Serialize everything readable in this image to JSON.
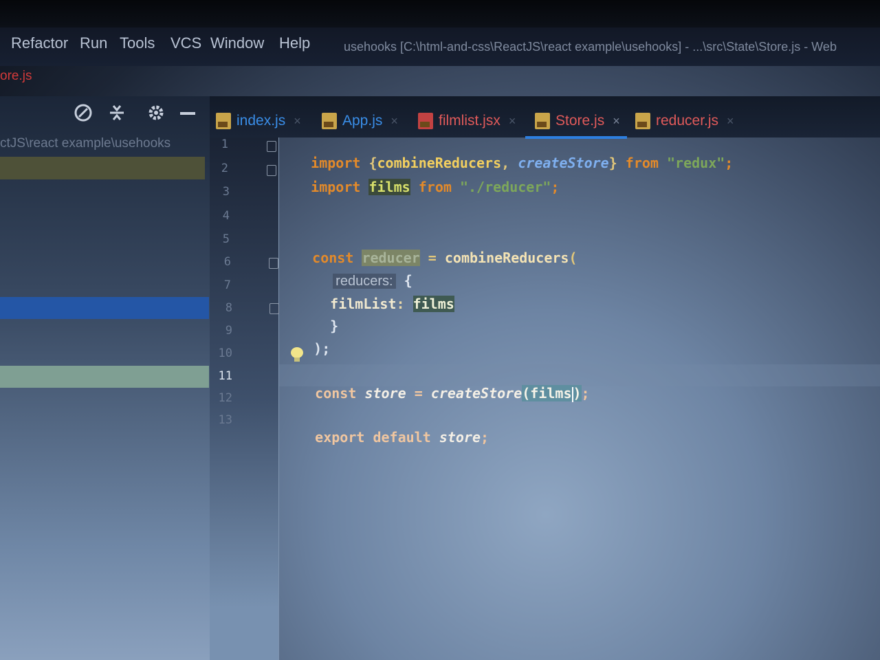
{
  "menu": [
    {
      "label": "Refactor",
      "mnemonic": "R"
    },
    {
      "label": "Run",
      "mnemonic": "u"
    },
    {
      "label": "Tools",
      "mnemonic": "T"
    },
    {
      "label": "VCS",
      "mnemonic": "S"
    },
    {
      "label": "Window",
      "mnemonic": "W"
    },
    {
      "label": "Help",
      "mnemonic": "H"
    }
  ],
  "window_title": "usehooks [C:\\html-and-css\\ReactJS\\react example\\usehooks] - ...\\src\\State\\Store.js - Web",
  "breadcrumb": "ore.js",
  "project_path": "ctJS\\react example\\usehooks",
  "toolbar": {
    "icons": [
      "globe-gear-icon",
      "collapse-icon",
      "gear-icon",
      "minimize-icon"
    ]
  },
  "tabs": [
    {
      "label": "index.js",
      "color": "#3a8ee8",
      "type": "js"
    },
    {
      "label": "App.js",
      "color": "#3a8ee8",
      "type": "js"
    },
    {
      "label": "filmlist.jsx",
      "color": "#e05a5a",
      "type": "jsx"
    },
    {
      "label": "Store.js",
      "color": "#e05a5a",
      "type": "js",
      "active": true
    },
    {
      "label": "reducer.js",
      "color": "#e05a5a",
      "type": "js"
    }
  ],
  "close_glyph": "×",
  "line_numbers": [
    "1",
    "2",
    "3",
    "4",
    "5",
    "6",
    "7",
    "8",
    "9",
    "10",
    "11",
    "12",
    "13"
  ],
  "current_line": "11",
  "code": {
    "l1": {
      "kw1": "import",
      "p1": " {",
      "id1": "combineReducers",
      "p2": ", ",
      "id2": "createStore",
      "p3": "} ",
      "kw2": "from",
      "sp": " ",
      "str": "\"redux\"",
      "end": ";"
    },
    "l2": {
      "kw1": "import",
      "sp1": " ",
      "id1": "films",
      "sp2": " ",
      "kw2": "from",
      "sp3": " ",
      "str": "\"./reducer\"",
      "end": ";"
    },
    "l5": {
      "kw": "const",
      "sp1": " ",
      "var": "reducer",
      "eq": " = ",
      "fn": "combineReducers",
      "p": "("
    },
    "l6": {
      "hint": "reducers:",
      "p": " {"
    },
    "l7": {
      "key": "filmList",
      "colon": ": ",
      "val": "films"
    },
    "l8": {
      "p": "}"
    },
    "l9": {
      "p": ");"
    },
    "l11": {
      "kw": "const",
      "sp1": " ",
      "var": "store",
      "eq": " = ",
      "fn": "createStore",
      "p1": "(",
      "arg": "films",
      "p2": ")",
      "end": ";"
    },
    "l13": {
      "kw1": "export",
      "sp1": " ",
      "kw2": "default",
      "sp2": " ",
      "var": "store",
      "end": ";"
    }
  }
}
